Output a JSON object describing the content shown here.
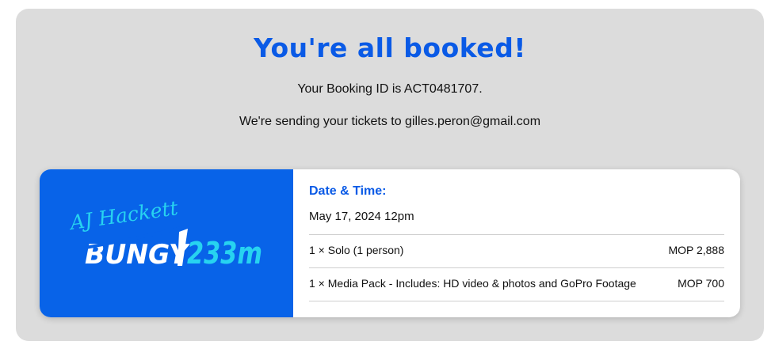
{
  "confirmation": {
    "headline": "You're all booked!",
    "booking_line": "Your Booking ID is ACT0481707.",
    "email_line": "We're sending your tickets to gilles.peron@gmail.com"
  },
  "logo": {
    "script_text": "AJ Hackett",
    "brand_text": "BUNGY",
    "height_text": "233m",
    "background_color": "#0863E8",
    "accent_color": "#27D3F0"
  },
  "booking": {
    "date_time_heading": "Date & Time:",
    "date_time_value": "May 17, 2024 12pm",
    "items": [
      {
        "description": "1 × Solo (1 person)",
        "price": "MOP 2,888"
      },
      {
        "description": "1 × Media Pack - Includes: HD video & photos and GoPro Footage",
        "price": "MOP 700"
      }
    ]
  },
  "colors": {
    "accent": "#0A5AE6",
    "panel_background": "#DCDCDC"
  }
}
